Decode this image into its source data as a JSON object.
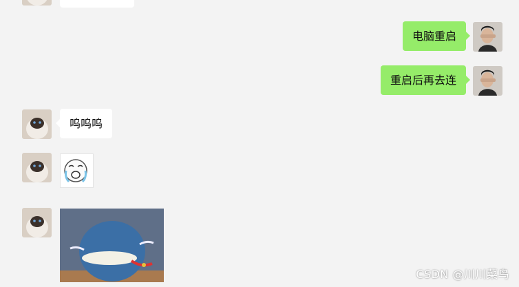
{
  "chat": {
    "messages": [
      {
        "side": "right",
        "text": "电脑重启"
      },
      {
        "side": "right",
        "text": "重启后再去连"
      },
      {
        "side": "left",
        "text": "呜呜呜"
      }
    ],
    "stickers": [
      {
        "name": "crying-face-sticker"
      },
      {
        "name": "cartoon-crying-sticker"
      }
    ]
  },
  "watermark": "CSDN @川川菜鸟",
  "colors": {
    "background": "#f3f3f3",
    "bubble_self": "#95ec69",
    "bubble_other": "#ffffff"
  }
}
